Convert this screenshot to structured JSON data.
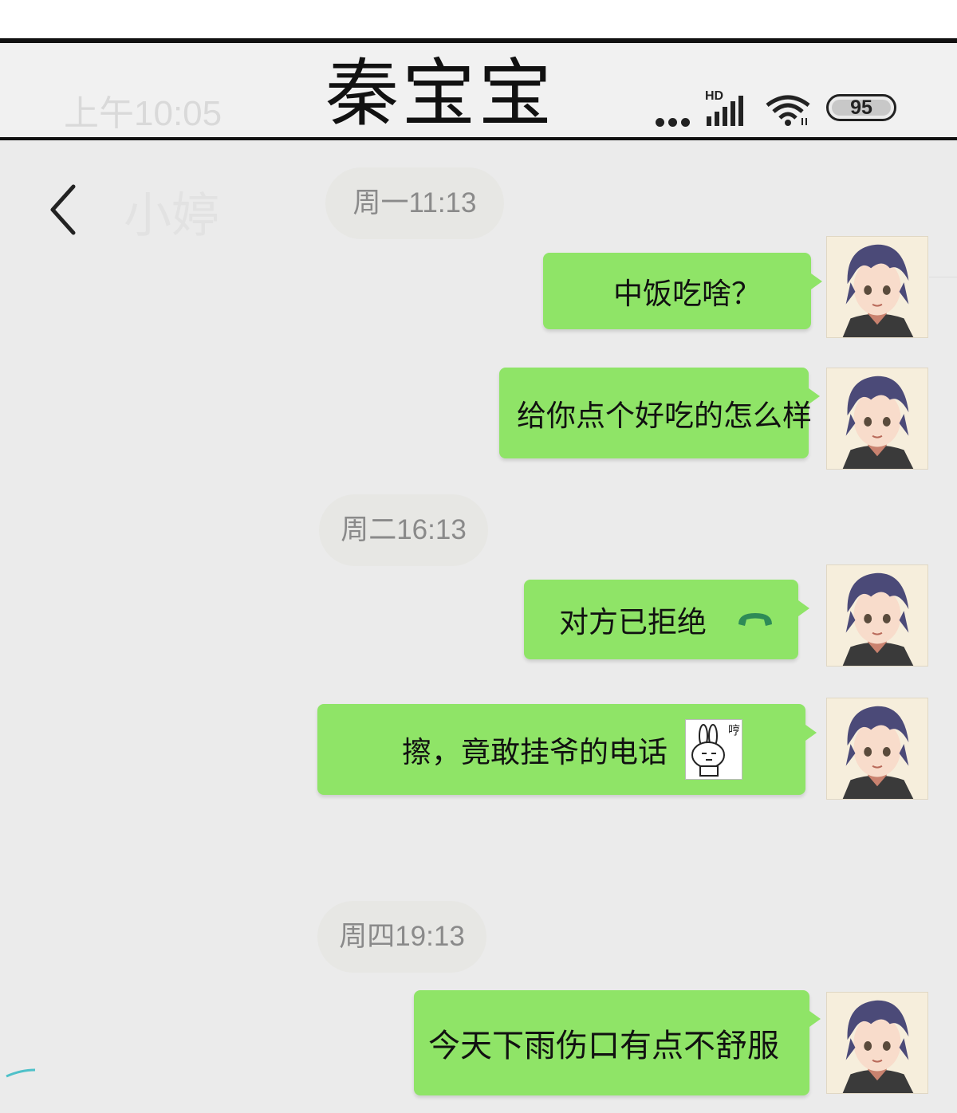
{
  "header": {
    "title": "秦宝宝",
    "faded_time": "上午10:05",
    "status": {
      "signal_label": "HD",
      "battery": "95"
    }
  },
  "nav": {
    "faded_contact_name": "小婷"
  },
  "icons": [
    "back-chevron-icon",
    "more-dots-icon",
    "signal-icon",
    "wifi-icon",
    "battery-icon",
    "declined-call-icon",
    "bunny-sticker-icon"
  ],
  "colors": {
    "bubble": "#8fe467",
    "background": "#ebebeb",
    "timestamp_text": "#8a8a8a"
  },
  "messages": {
    "ts1": "周一11:13",
    "m1": "中饭吃啥？",
    "m2": "给你点个好吃的怎么样",
    "ts2": "周二16:13",
    "m3": "对方已拒绝",
    "m4": "擦，竟敢挂爷的电话",
    "m4_sticker_caption": "哼",
    "ts3": "周四19:13",
    "m5": "今天下雨伤口有点不舒服"
  }
}
